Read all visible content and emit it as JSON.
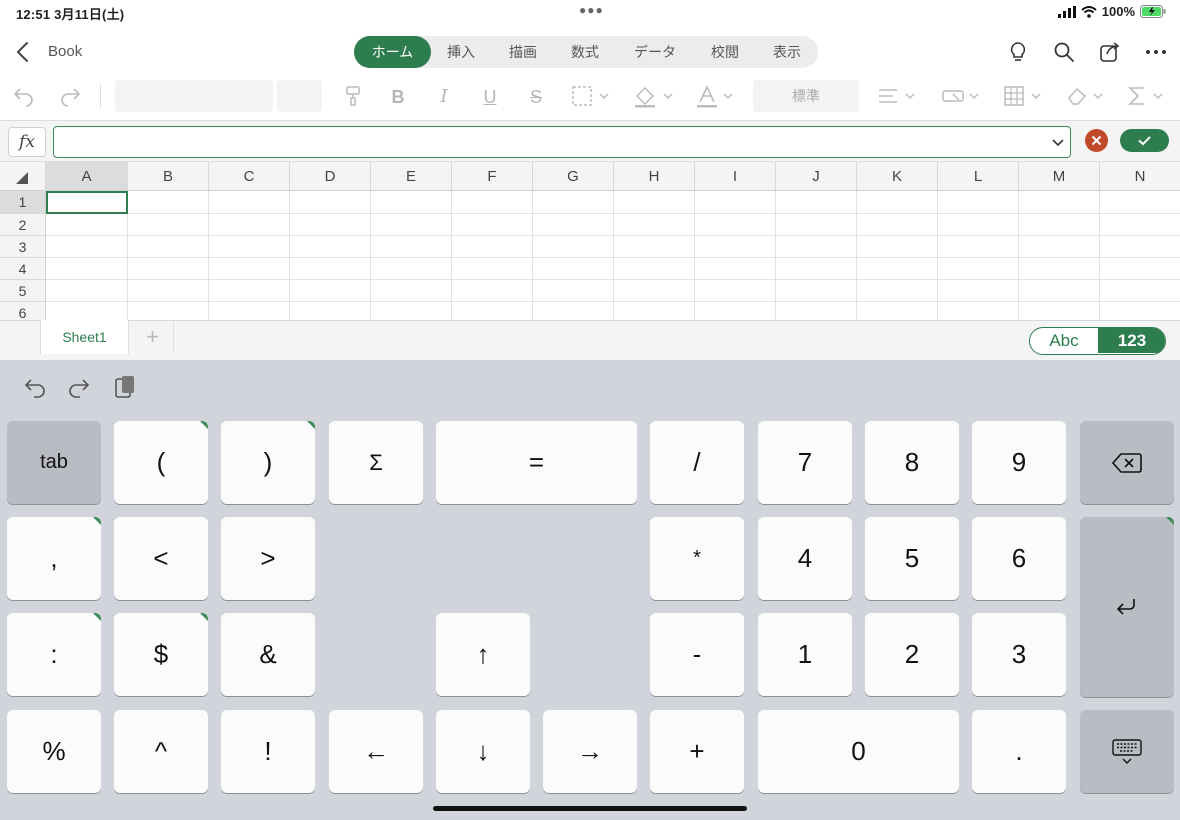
{
  "status": {
    "time": "12:51",
    "date": "3月11日(土)",
    "battery": "100%"
  },
  "header": {
    "title": "Book"
  },
  "tabs": [
    "ホーム",
    "挿入",
    "描画",
    "数式",
    "データ",
    "校閲",
    "表示"
  ],
  "ribbon": {
    "number_format": "標準"
  },
  "formula": {
    "fx_label": "fx",
    "value": ""
  },
  "columns": [
    "A",
    "B",
    "C",
    "D",
    "E",
    "F",
    "G",
    "H",
    "I",
    "J",
    "K",
    "L",
    "M",
    "N"
  ],
  "rows": [
    "1",
    "2",
    "3",
    "4",
    "5",
    "6"
  ],
  "sheets": {
    "active": "Sheet1",
    "add": "+"
  },
  "mode": {
    "abc": "Abc",
    "num": "123"
  },
  "keys": {
    "tab": "tab",
    "lparen": "(",
    "rparen": ")",
    "sigma": "Σ",
    "equals": "=",
    "slash": "/",
    "k7": "7",
    "k8": "8",
    "k9": "9",
    "comma": ",",
    "lt": "<",
    "gt": ">",
    "star": "*",
    "k4": "4",
    "k5": "5",
    "k6": "6",
    "colon": ":",
    "dollar": "$",
    "amp": "&",
    "up": "↑",
    "minus": "-",
    "k1": "1",
    "k2": "2",
    "k3": "3",
    "percent": "%",
    "caret": "^",
    "bang": "!",
    "left": "←",
    "down": "↓",
    "right": "→",
    "plus": "+",
    "k0": "0",
    "dot": "."
  },
  "colors": {
    "accent": "#2e7d4f",
    "cancel": "#c14a2a"
  }
}
